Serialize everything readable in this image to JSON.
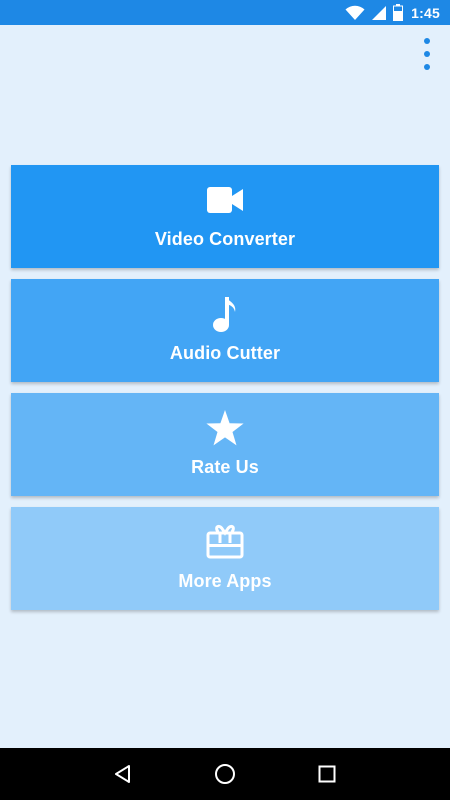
{
  "status_bar": {
    "time": "1:45",
    "icons": [
      "wifi-icon",
      "signal-icon",
      "battery-icon"
    ]
  },
  "top_bar": {
    "overflow_icon": "more-vert-icon"
  },
  "menu": {
    "items": [
      {
        "label": "Video Converter",
        "icon": "video-camera-icon",
        "color": "#2196f3"
      },
      {
        "label": "Audio Cutter",
        "icon": "music-note-icon",
        "color": "#42a5f5"
      },
      {
        "label": "Rate Us",
        "icon": "star-icon",
        "color": "#64b5f6"
      },
      {
        "label": "More Apps",
        "icon": "gift-card-icon",
        "color": "#90caf9"
      }
    ]
  },
  "nav_bar": {
    "buttons": [
      "back-icon",
      "home-icon",
      "recents-icon"
    ]
  },
  "colors": {
    "accent": "#1e88e5",
    "background": "#e3f0fc"
  }
}
